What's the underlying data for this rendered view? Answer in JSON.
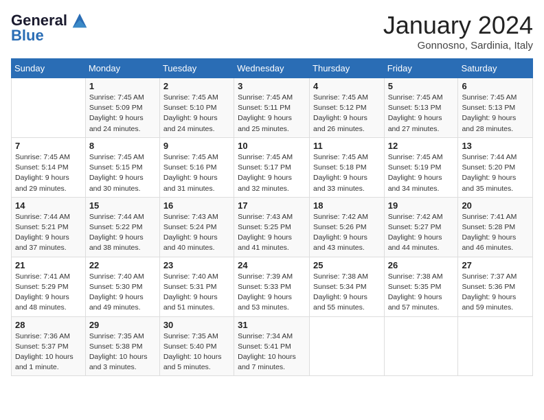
{
  "header": {
    "logo_line1": "General",
    "logo_line2": "Blue",
    "month": "January 2024",
    "location": "Gonnosno, Sardinia, Italy"
  },
  "weekdays": [
    "Sunday",
    "Monday",
    "Tuesday",
    "Wednesday",
    "Thursday",
    "Friday",
    "Saturday"
  ],
  "weeks": [
    [
      {
        "day": "",
        "sunrise": "",
        "sunset": "",
        "daylight": ""
      },
      {
        "day": "1",
        "sunrise": "Sunrise: 7:45 AM",
        "sunset": "Sunset: 5:09 PM",
        "daylight": "Daylight: 9 hours and 24 minutes."
      },
      {
        "day": "2",
        "sunrise": "Sunrise: 7:45 AM",
        "sunset": "Sunset: 5:10 PM",
        "daylight": "Daylight: 9 hours and 24 minutes."
      },
      {
        "day": "3",
        "sunrise": "Sunrise: 7:45 AM",
        "sunset": "Sunset: 5:11 PM",
        "daylight": "Daylight: 9 hours and 25 minutes."
      },
      {
        "day": "4",
        "sunrise": "Sunrise: 7:45 AM",
        "sunset": "Sunset: 5:12 PM",
        "daylight": "Daylight: 9 hours and 26 minutes."
      },
      {
        "day": "5",
        "sunrise": "Sunrise: 7:45 AM",
        "sunset": "Sunset: 5:13 PM",
        "daylight": "Daylight: 9 hours and 27 minutes."
      },
      {
        "day": "6",
        "sunrise": "Sunrise: 7:45 AM",
        "sunset": "Sunset: 5:13 PM",
        "daylight": "Daylight: 9 hours and 28 minutes."
      }
    ],
    [
      {
        "day": "7",
        "sunrise": "Sunrise: 7:45 AM",
        "sunset": "Sunset: 5:14 PM",
        "daylight": "Daylight: 9 hours and 29 minutes."
      },
      {
        "day": "8",
        "sunrise": "Sunrise: 7:45 AM",
        "sunset": "Sunset: 5:15 PM",
        "daylight": "Daylight: 9 hours and 30 minutes."
      },
      {
        "day": "9",
        "sunrise": "Sunrise: 7:45 AM",
        "sunset": "Sunset: 5:16 PM",
        "daylight": "Daylight: 9 hours and 31 minutes."
      },
      {
        "day": "10",
        "sunrise": "Sunrise: 7:45 AM",
        "sunset": "Sunset: 5:17 PM",
        "daylight": "Daylight: 9 hours and 32 minutes."
      },
      {
        "day": "11",
        "sunrise": "Sunrise: 7:45 AM",
        "sunset": "Sunset: 5:18 PM",
        "daylight": "Daylight: 9 hours and 33 minutes."
      },
      {
        "day": "12",
        "sunrise": "Sunrise: 7:45 AM",
        "sunset": "Sunset: 5:19 PM",
        "daylight": "Daylight: 9 hours and 34 minutes."
      },
      {
        "day": "13",
        "sunrise": "Sunrise: 7:44 AM",
        "sunset": "Sunset: 5:20 PM",
        "daylight": "Daylight: 9 hours and 35 minutes."
      }
    ],
    [
      {
        "day": "14",
        "sunrise": "Sunrise: 7:44 AM",
        "sunset": "Sunset: 5:21 PM",
        "daylight": "Daylight: 9 hours and 37 minutes."
      },
      {
        "day": "15",
        "sunrise": "Sunrise: 7:44 AM",
        "sunset": "Sunset: 5:22 PM",
        "daylight": "Daylight: 9 hours and 38 minutes."
      },
      {
        "day": "16",
        "sunrise": "Sunrise: 7:43 AM",
        "sunset": "Sunset: 5:24 PM",
        "daylight": "Daylight: 9 hours and 40 minutes."
      },
      {
        "day": "17",
        "sunrise": "Sunrise: 7:43 AM",
        "sunset": "Sunset: 5:25 PM",
        "daylight": "Daylight: 9 hours and 41 minutes."
      },
      {
        "day": "18",
        "sunrise": "Sunrise: 7:42 AM",
        "sunset": "Sunset: 5:26 PM",
        "daylight": "Daylight: 9 hours and 43 minutes."
      },
      {
        "day": "19",
        "sunrise": "Sunrise: 7:42 AM",
        "sunset": "Sunset: 5:27 PM",
        "daylight": "Daylight: 9 hours and 44 minutes."
      },
      {
        "day": "20",
        "sunrise": "Sunrise: 7:41 AM",
        "sunset": "Sunset: 5:28 PM",
        "daylight": "Daylight: 9 hours and 46 minutes."
      }
    ],
    [
      {
        "day": "21",
        "sunrise": "Sunrise: 7:41 AM",
        "sunset": "Sunset: 5:29 PM",
        "daylight": "Daylight: 9 hours and 48 minutes."
      },
      {
        "day": "22",
        "sunrise": "Sunrise: 7:40 AM",
        "sunset": "Sunset: 5:30 PM",
        "daylight": "Daylight: 9 hours and 49 minutes."
      },
      {
        "day": "23",
        "sunrise": "Sunrise: 7:40 AM",
        "sunset": "Sunset: 5:31 PM",
        "daylight": "Daylight: 9 hours and 51 minutes."
      },
      {
        "day": "24",
        "sunrise": "Sunrise: 7:39 AM",
        "sunset": "Sunset: 5:33 PM",
        "daylight": "Daylight: 9 hours and 53 minutes."
      },
      {
        "day": "25",
        "sunrise": "Sunrise: 7:38 AM",
        "sunset": "Sunset: 5:34 PM",
        "daylight": "Daylight: 9 hours and 55 minutes."
      },
      {
        "day": "26",
        "sunrise": "Sunrise: 7:38 AM",
        "sunset": "Sunset: 5:35 PM",
        "daylight": "Daylight: 9 hours and 57 minutes."
      },
      {
        "day": "27",
        "sunrise": "Sunrise: 7:37 AM",
        "sunset": "Sunset: 5:36 PM",
        "daylight": "Daylight: 9 hours and 59 minutes."
      }
    ],
    [
      {
        "day": "28",
        "sunrise": "Sunrise: 7:36 AM",
        "sunset": "Sunset: 5:37 PM",
        "daylight": "Daylight: 10 hours and 1 minute."
      },
      {
        "day": "29",
        "sunrise": "Sunrise: 7:35 AM",
        "sunset": "Sunset: 5:38 PM",
        "daylight": "Daylight: 10 hours and 3 minutes."
      },
      {
        "day": "30",
        "sunrise": "Sunrise: 7:35 AM",
        "sunset": "Sunset: 5:40 PM",
        "daylight": "Daylight: 10 hours and 5 minutes."
      },
      {
        "day": "31",
        "sunrise": "Sunrise: 7:34 AM",
        "sunset": "Sunset: 5:41 PM",
        "daylight": "Daylight: 10 hours and 7 minutes."
      },
      {
        "day": "",
        "sunrise": "",
        "sunset": "",
        "daylight": ""
      },
      {
        "day": "",
        "sunrise": "",
        "sunset": "",
        "daylight": ""
      },
      {
        "day": "",
        "sunrise": "",
        "sunset": "",
        "daylight": ""
      }
    ]
  ]
}
